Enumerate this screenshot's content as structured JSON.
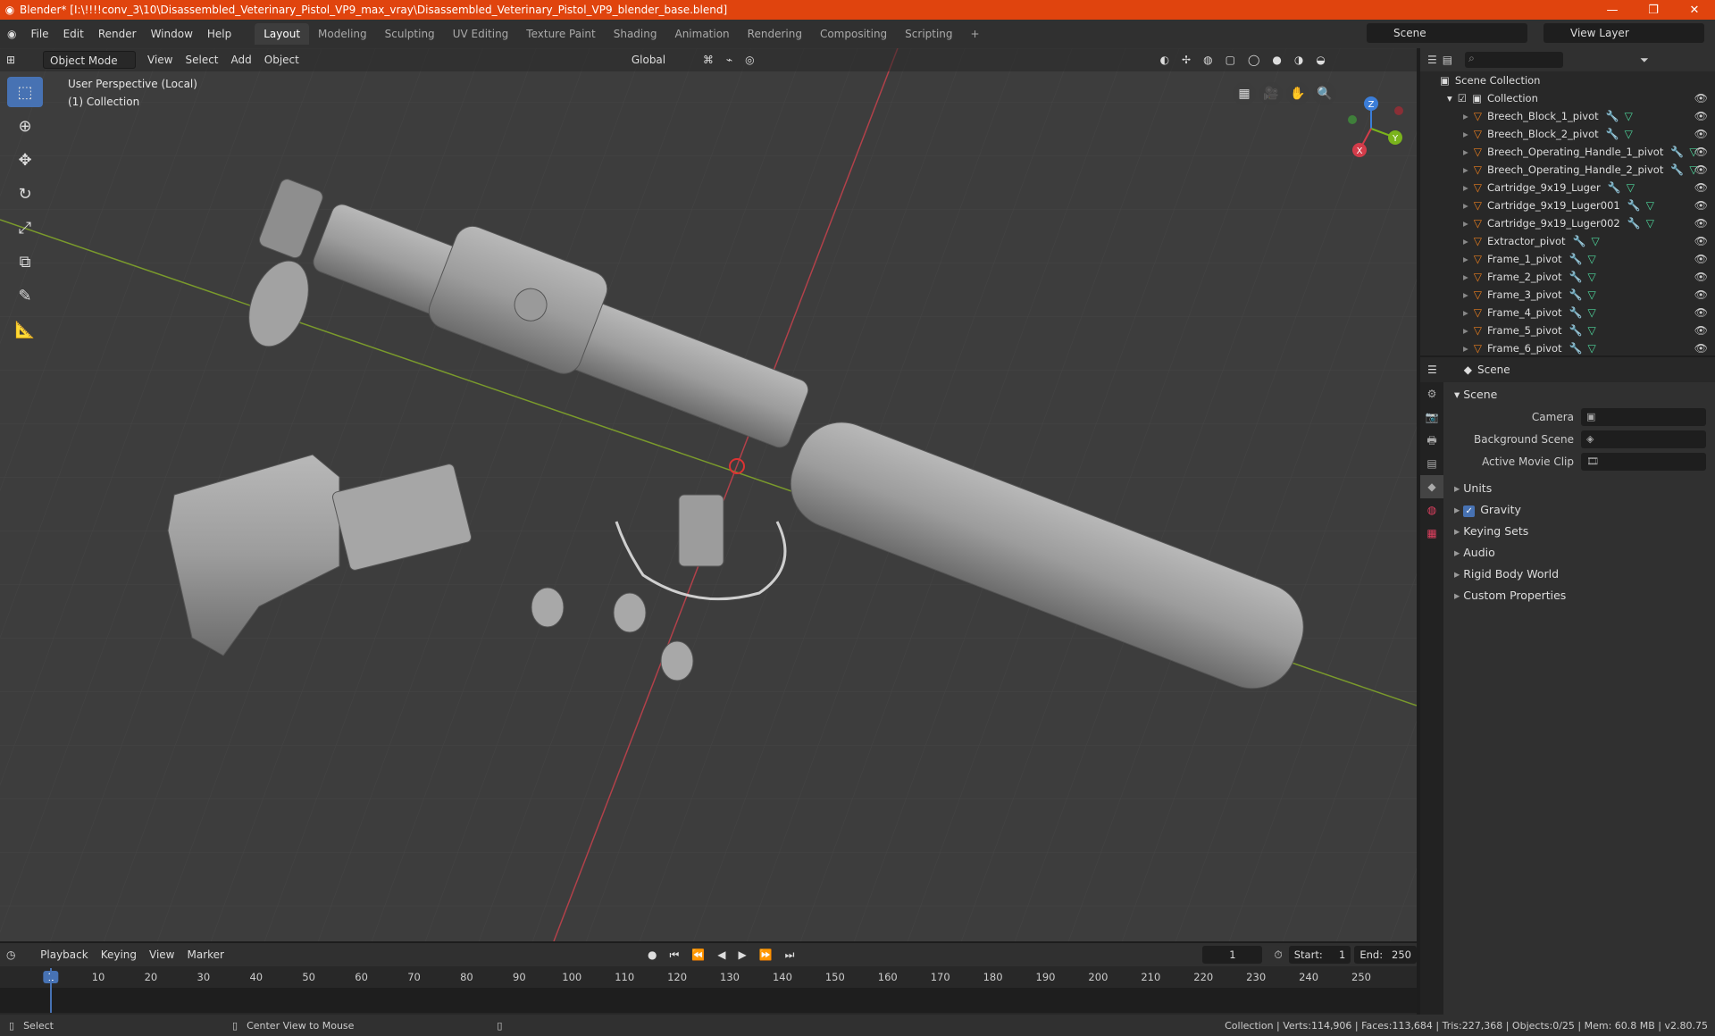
{
  "window": {
    "title": "Blender* [I:\\!!!!conv_3\\10\\Disassembled_Veterinary_Pistol_VP9_max_vray\\Disassembled_Veterinary_Pistol_VP9_blender_base.blend]",
    "minimize": "—",
    "maximize": "❐",
    "close": "✕"
  },
  "menu": [
    "File",
    "Edit",
    "Render",
    "Window",
    "Help"
  ],
  "workspaces": [
    "Layout",
    "Modeling",
    "Sculpting",
    "UV Editing",
    "Texture Paint",
    "Shading",
    "Animation",
    "Rendering",
    "Compositing",
    "Scripting"
  ],
  "active_workspace": "Layout",
  "scene_name": "Scene",
  "view_layer": "View Layer",
  "viewport": {
    "mode": "Object Mode",
    "menus": [
      "View",
      "Select",
      "Add",
      "Object"
    ],
    "transform_orientation": "Global",
    "info_line1": "User Perspective (Local)",
    "info_line2": "(1) Collection"
  },
  "gizmo": {
    "x": "X",
    "y": "Y",
    "z": "Z"
  },
  "outliner": {
    "root": "Scene Collection",
    "collection": "Collection",
    "items": [
      "Breech_Block_1_pivot",
      "Breech_Block_2_pivot",
      "Breech_Operating_Handle_1_pivot",
      "Breech_Operating_Handle_2_pivot",
      "Cartridge_9x19_Luger",
      "Cartridge_9x19_Luger001",
      "Cartridge_9x19_Luger002",
      "Extractor_pivot",
      "Frame_1_pivot",
      "Frame_2_pivot",
      "Frame_3_pivot",
      "Frame_4_pivot",
      "Frame_5_pivot",
      "Frame_6_pivot"
    ]
  },
  "properties": {
    "header": "Scene",
    "panel": "Scene",
    "camera_label": "Camera",
    "bg_scene_label": "Background Scene",
    "movie_clip_label": "Active Movie Clip",
    "sections": [
      "Units",
      "Gravity",
      "Keying Sets",
      "Audio",
      "Rigid Body World",
      "Custom Properties"
    ]
  },
  "timeline": {
    "menus": [
      "Playback",
      "Keying",
      "View",
      "Marker"
    ],
    "current_frame": "1",
    "start_label": "Start:",
    "start": "1",
    "end_label": "End:",
    "end": "250",
    "ticks": [
      "1",
      "10",
      "20",
      "30",
      "40",
      "50",
      "60",
      "70",
      "80",
      "90",
      "100",
      "110",
      "120",
      "130",
      "140",
      "150",
      "160",
      "170",
      "180",
      "190",
      "200",
      "210",
      "220",
      "230",
      "240",
      "250"
    ]
  },
  "status": {
    "left": "Select",
    "middle": "Center View to Mouse",
    "right": "Collection | Verts:114,906 | Faces:113,684 | Tris:227,368 | Objects:0/25 | Mem: 60.8 MB | v2.80.75"
  }
}
